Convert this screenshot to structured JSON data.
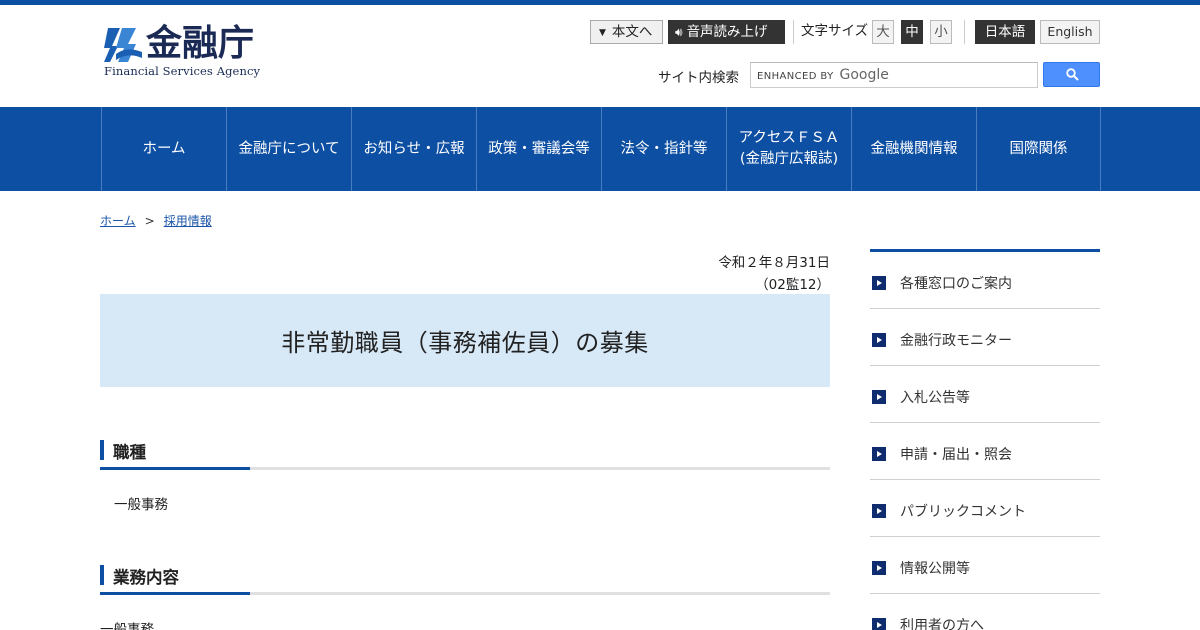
{
  "header": {
    "logo_text": "金融庁",
    "logo_subtext": "Financial Services Agency",
    "skip_link": "本文へ",
    "voice_button": "音声読み上げ",
    "font_size_label": "文字サイズ",
    "font_size_options": [
      "大",
      "中",
      "小"
    ],
    "font_size_selected": "中",
    "lang_japanese": "日本語",
    "lang_english": "English",
    "search_label": "サイト内検索",
    "search_placeholder_prefix": "ENHANCED BY",
    "search_placeholder_brand": "Google"
  },
  "nav": {
    "items": [
      {
        "label": "ホーム"
      },
      {
        "label": "金融庁について"
      },
      {
        "label": "お知らせ・広報"
      },
      {
        "label": "政策・審議会等"
      },
      {
        "label": "法令・指針等"
      },
      {
        "label": "アクセスＦＳＡ\n(金融庁広報誌)"
      },
      {
        "label": "金融機関情報"
      },
      {
        "label": "国際関係"
      }
    ]
  },
  "breadcrumb": {
    "home": "ホーム",
    "separator": ">",
    "current": "採用情報"
  },
  "main": {
    "date": "令和２年８月31日",
    "doc_number": "（02監12）",
    "title": "非常勤職員（事務補佐員）の募集",
    "sections": [
      {
        "heading": "職種",
        "body": "一般事務"
      },
      {
        "heading": "業務内容",
        "body": "一般事務"
      }
    ]
  },
  "sidebar": {
    "items": [
      {
        "label": "各種窓口のご案内"
      },
      {
        "label": "金融行政モニター"
      },
      {
        "label": "入札公告等"
      },
      {
        "label": "申請・届出・照会"
      },
      {
        "label": "パブリックコメント"
      },
      {
        "label": "情報公開等"
      },
      {
        "label": "利用者の方へ"
      }
    ]
  },
  "colors": {
    "brand_blue": "#0d4fa3",
    "title_bg": "#d7e8f7",
    "sidebar_marker": "#0e2c6e"
  }
}
